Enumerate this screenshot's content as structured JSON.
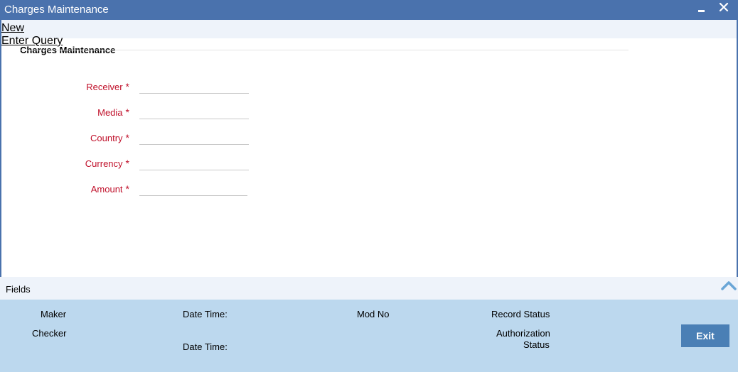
{
  "window": {
    "title": "Charges Maintenance"
  },
  "toolbar": {
    "new_label": "New",
    "enter_query_label": "Enter Query"
  },
  "section": {
    "title": "Charges Maintenance"
  },
  "fields": [
    {
      "label": "Receiver",
      "required_mark": "*",
      "value": ""
    },
    {
      "label": "Media",
      "required_mark": "*",
      "value": ""
    },
    {
      "label": "Country",
      "required_mark": "*",
      "value": ""
    },
    {
      "label": "Currency",
      "required_mark": "*",
      "value": ""
    },
    {
      "label": "Amount",
      "required_mark": "*",
      "value": ""
    }
  ],
  "fields_bar": {
    "label": "Fields"
  },
  "footer": {
    "maker_label": "Maker",
    "checker_label": "Checker",
    "date_time_label_1": "Date Time:",
    "date_time_label_2": "Date Time:",
    "mod_no_label": "Mod No",
    "record_status_label": "Record Status",
    "authorization_label": "Authorization",
    "status_label": "Status",
    "exit_label": "Exit"
  },
  "colors": {
    "titlebar": "#4a72ad",
    "required_label": "#c0102a",
    "footer_bg": "#bcd8ee",
    "exit_button": "#4a7fb5"
  },
  "icons": {
    "minimize": "minimize-icon",
    "close": "close-icon",
    "collapse": "chevron-up-icon"
  }
}
